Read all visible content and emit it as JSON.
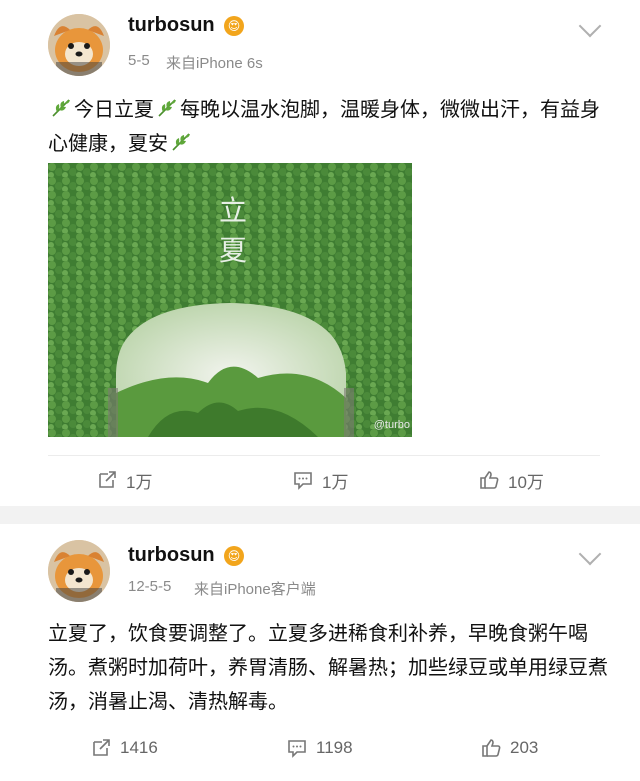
{
  "posts": [
    {
      "username": "turbosun",
      "vip_badge": "😍",
      "date": "5-5",
      "source": "来自iPhone 6s",
      "text_segments": [
        "今日立夏",
        "每晚以温水泡脚，温暖身体，微微出汗，有益身心健康，夏安"
      ],
      "leaf_icon": "leaf-icon",
      "image": {
        "overlay_title": "立夏",
        "watermark": "@turbo"
      },
      "actions": {
        "repost": "1万",
        "comment": "1万",
        "like": "10万"
      }
    },
    {
      "username": "turbosun",
      "vip_badge": "😍",
      "date": "12-5-5",
      "source": "来自iPhone客户端",
      "text": "立夏了，饮食要调整了。立夏多进稀食利补养，早晚食粥午喝汤。煮粥时加荷叶，养胃清肠、解暑热；加些绿豆或单用绿豆煮汤，消暑止渴、清热解毒。",
      "actions": {
        "repost": "1416",
        "comment": "1198",
        "like": "203"
      }
    }
  ],
  "colors": {
    "separator": "#f2f2f2",
    "meta_text": "#8a8a8a",
    "vip": "#f2a51c",
    "leaf": "#5fa83a"
  }
}
